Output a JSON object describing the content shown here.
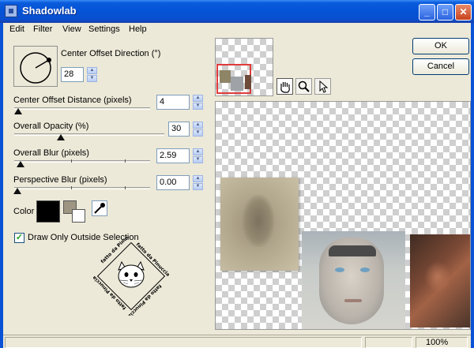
{
  "window": {
    "title": "Shadowlab"
  },
  "menu": [
    "Edit",
    "Filter",
    "View",
    "Settings",
    "Help"
  ],
  "controls": {
    "direction": {
      "label": "Center Offset Direction (°)",
      "value": "28"
    },
    "distance": {
      "label": "Center Offset Distance (pixels)",
      "value": "4"
    },
    "opacity": {
      "label": "Overall Opacity (%)",
      "value": "30"
    },
    "blur": {
      "label": "Overall Blur (pixels)",
      "value": "2.59"
    },
    "perspective": {
      "label": "Perspective Blur (pixels)",
      "value": "0.00"
    },
    "color_label": "Color",
    "color_value": "#000000",
    "draw_outside": {
      "label": "Draw Only Outside Selection",
      "checked": true
    }
  },
  "watermark": {
    "text": "fatto da Pinuccia"
  },
  "buttons": {
    "ok": "OK",
    "cancel": "Cancel"
  },
  "tools": [
    "hand-icon",
    "zoom-icon",
    "pointer-icon"
  ],
  "status": {
    "zoom": "100%"
  }
}
